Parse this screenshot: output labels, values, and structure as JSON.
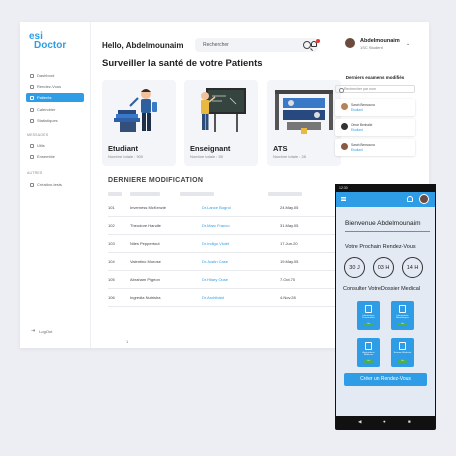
{
  "sidebar": {
    "logo_line1": "esi",
    "logo_line2": "Doctor",
    "items": [
      {
        "label": "Dashbord"
      },
      {
        "label": "Rendez-Vous"
      },
      {
        "label": "Patients"
      },
      {
        "label": "Calendrier"
      },
      {
        "label": "Statistiques"
      }
    ],
    "section_messages": "MESSAGES",
    "messages": [
      {
        "label": "Utils"
      },
      {
        "label": "Ensemble"
      }
    ],
    "section_autres": "AUTRES",
    "autres": [
      {
        "label": "Création-tests"
      }
    ],
    "logout": "LogOut"
  },
  "header": {
    "greeting": "Hello, Abdelmounaim",
    "search_placeholder": "Rechercher",
    "user_name": "Abdelmounaim",
    "user_role": "1SC Student"
  },
  "main": {
    "title": "Surveiller la santé de votre Patients",
    "cards": [
      {
        "title": "Etudiant",
        "subtitle": "Nombre totale : 900"
      },
      {
        "title": "Enseignant",
        "subtitle": "Nombre totale : 55"
      },
      {
        "title": "ATS",
        "subtitle": "Nombre totale : 28"
      }
    ]
  },
  "recent": {
    "title": "Derniers examens modifiés",
    "search_placeholder": "Rechercher par nom",
    "items": [
      {
        "name": "Sarah Bensouna",
        "role": "Etudiant"
      },
      {
        "name": "Omar Benhalid",
        "role": "Etudiant"
      },
      {
        "name": "Sarah Bensouna",
        "role": "Etudiant"
      }
    ]
  },
  "table": {
    "title": "DERNIERE MODIFICATION",
    "rows": [
      {
        "id": "101",
        "name": "Inverness McKenzie",
        "doctor": "Dr.Lance Bogrol",
        "date": "24.May.05"
      },
      {
        "id": "102",
        "name": "Theodore Handle",
        "doctor": "Dr.Marc Franco",
        "date": "31.May.05"
      },
      {
        "id": "103",
        "name": "Niles Peppertout",
        "doctor": "Dr.Indigo Violet",
        "date": "17.Jun.20"
      },
      {
        "id": "104",
        "name": "Valentino Morose",
        "doctor": "Dr.Justin Case",
        "date": "19.May.05"
      },
      {
        "id": "105",
        "name": "Abraham Pigeon",
        "doctor": "Dr.Hilary Ouse",
        "date": "7.Oct.70"
      },
      {
        "id": "106",
        "name": "Ingredia Nutrisha",
        "doctor": "Dr.Archibald",
        "date": "4.Nov.28"
      }
    ],
    "footer": "1"
  },
  "mobile": {
    "status_time": "12:30",
    "welcome": "Bienvenue Abdelmounaim",
    "next_rdv_title": "Votre Prochain Rendez-Vous",
    "countdown": [
      "30 J",
      "03 H",
      "14 H"
    ],
    "consult_title": "Consulter VotreDossier Medical",
    "tiles": [
      {
        "label": "Informations Personnelles",
        "badge": "Voir"
      },
      {
        "label": "Informations Biométriques",
        "badge": "Voir"
      },
      {
        "label": "Antécédents Médicaux",
        "badge": "Voir"
      },
      {
        "label": "Examen Médicale",
        "badge": "Voir"
      }
    ],
    "create_button": "Créer un Rendez-Vous",
    "nav": [
      "◀",
      "●",
      "■"
    ]
  },
  "colors": {
    "accent": "#2e9de6",
    "active_badge": "#4caf50",
    "notification": "#e53935"
  }
}
